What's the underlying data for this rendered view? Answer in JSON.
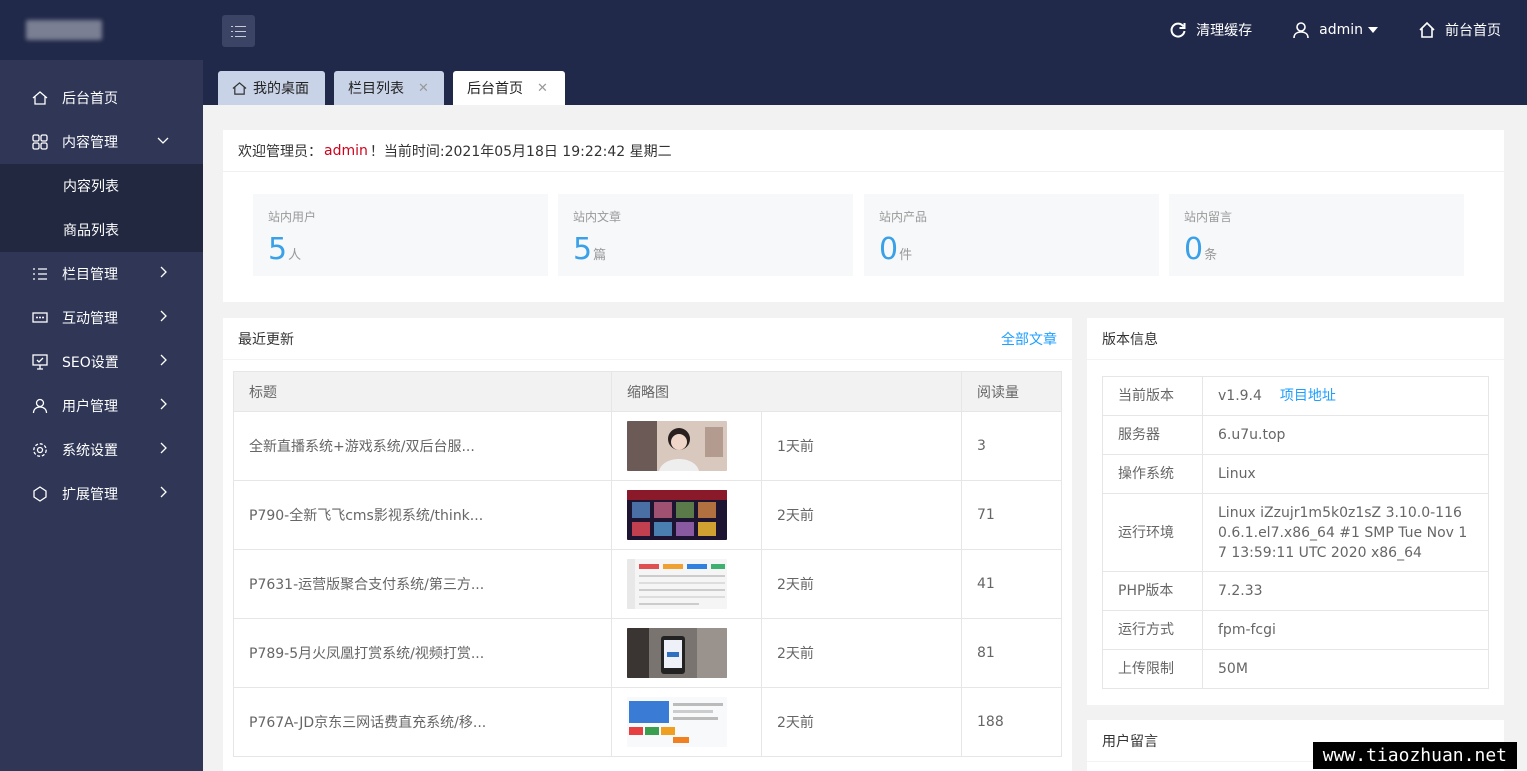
{
  "header": {
    "clear_cache": "清理缓存",
    "user": "admin",
    "front_home": "前台首页"
  },
  "sidebar": {
    "items": [
      {
        "label": "后台首页",
        "icon": "home-icon"
      },
      {
        "label": "内容管理",
        "icon": "grid-icon",
        "expanded": true,
        "children": [
          "内容列表",
          "商品列表"
        ]
      },
      {
        "label": "栏目管理",
        "icon": "list-icon"
      },
      {
        "label": "互动管理",
        "icon": "chat-icon"
      },
      {
        "label": "SEO设置",
        "icon": "seo-icon"
      },
      {
        "label": "用户管理",
        "icon": "user-icon"
      },
      {
        "label": "系统设置",
        "icon": "gear-icon"
      },
      {
        "label": "扩展管理",
        "icon": "extension-icon"
      }
    ]
  },
  "tabs": [
    {
      "label": "我的桌面",
      "closable": false
    },
    {
      "label": "栏目列表",
      "closable": true
    },
    {
      "label": "后台首页",
      "closable": true,
      "active": true
    }
  ],
  "welcome": {
    "prefix": "欢迎管理员：",
    "user": "admin",
    "suffix": "！当前时间:2021年05月18日 19:22:42 星期二"
  },
  "stats": [
    {
      "label": "站内用户",
      "value": "5",
      "unit": "人"
    },
    {
      "label": "站内文章",
      "value": "5",
      "unit": "篇"
    },
    {
      "label": "站内产品",
      "value": "0",
      "unit": "件"
    },
    {
      "label": "站内留言",
      "value": "0",
      "unit": "条"
    }
  ],
  "recent": {
    "title": "最近更新",
    "link": "全部文章",
    "columns": [
      "标题",
      "缩略图",
      "阅读量"
    ],
    "rows": [
      {
        "title": "全新直播系统+游戏系统/双后台服...",
        "time": "1天前",
        "views": "3"
      },
      {
        "title": "P790-全新飞飞cms影视系统/think...",
        "time": "2天前",
        "views": "71"
      },
      {
        "title": "P7631-运营版聚合支付系统/第三方...",
        "time": "2天前",
        "views": "41"
      },
      {
        "title": "P789-5月火凤凰打赏系统/视频打赏...",
        "time": "2天前",
        "views": "81"
      },
      {
        "title": "P767A-JD京东三网话费直充系统/移...",
        "time": "2天前",
        "views": "188"
      }
    ]
  },
  "version": {
    "title": "版本信息",
    "rows": [
      {
        "key": "当前版本",
        "value": "v1.9.4",
        "link": "项目地址"
      },
      {
        "key": "服务器",
        "value": "6.u7u.top"
      },
      {
        "key": "操作系统",
        "value": "Linux"
      },
      {
        "key": "运行环境",
        "value": "Linux iZzujr1m5k0z1sZ 3.10.0-1160.6.1.el7.x86_64 #1 SMP Tue Nov 17 13:59:11 UTC 2020 x86_64"
      },
      {
        "key": "PHP版本",
        "value": "7.2.33"
      },
      {
        "key": "运行方式",
        "value": "fpm-fcgi"
      },
      {
        "key": "上传限制",
        "value": "50M"
      }
    ]
  },
  "messages": {
    "title": "用户留言"
  },
  "watermark": "www.tiaozhuan.net"
}
